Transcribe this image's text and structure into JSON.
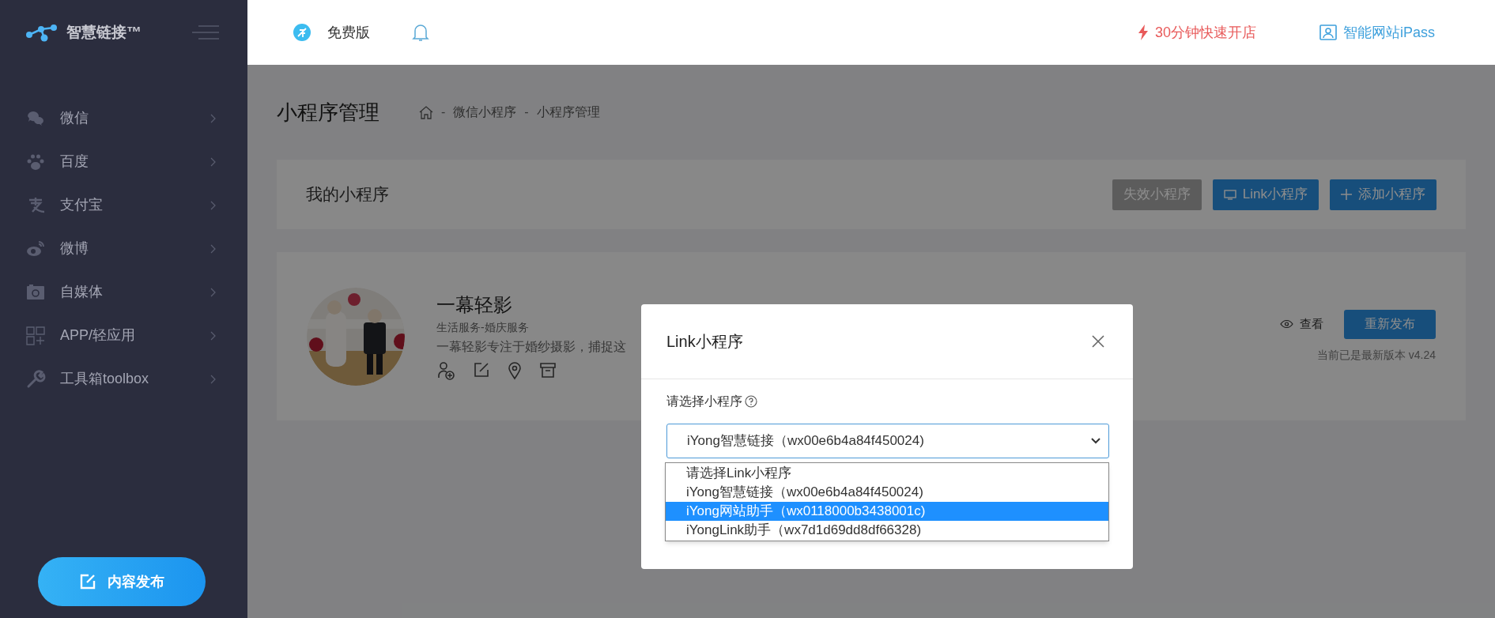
{
  "sidebar": {
    "brand": "智慧链接™",
    "items": [
      {
        "label": "微信"
      },
      {
        "label": "百度"
      },
      {
        "label": "支付宝"
      },
      {
        "label": "微博"
      },
      {
        "label": "自媒体"
      },
      {
        "label": "APP/轻应用"
      },
      {
        "label": "工具箱toolbox"
      }
    ],
    "publish_button": "内容发布"
  },
  "topbar": {
    "edition": "免费版",
    "links": [
      {
        "label": "30分钟快速开店",
        "kind": "shop"
      },
      {
        "label": "智能网站iPass",
        "kind": "site"
      }
    ]
  },
  "page": {
    "title": "小程序管理",
    "breadcrumb": [
      "微信小程序",
      "小程序管理"
    ],
    "separator": "-"
  },
  "panel": {
    "title": "我的小程序",
    "buttons": [
      {
        "label": "失效小程序",
        "kind": "plain",
        "disabled": true
      },
      {
        "label": "Link小程序",
        "kind": "link",
        "disabled": false
      },
      {
        "label": "添加小程序",
        "kind": "add",
        "disabled": false
      }
    ]
  },
  "app": {
    "name": "一幕轻影",
    "category": "生活服务-婚庆服务",
    "description": "一幕轻影专注于婚纱摄影，捕捉这",
    "view": "查看",
    "republish": "重新发布",
    "version": "当前已是最新版本 v4.24"
  },
  "modal": {
    "title": "Link小程序",
    "field_label": "请选择小程序",
    "select_value": "iYong智慧链接（wx00e6b4a84f450024)",
    "options": [
      {
        "label": "请选择Link小程序",
        "selected": false
      },
      {
        "label": "iYong智慧链接（wx00e6b4a84f450024)",
        "selected": false
      },
      {
        "label": "iYong网站助手（wx0118000b3438001c)",
        "selected": true
      },
      {
        "label": "iYongLink助手（wx7d1d69dd8df66328)",
        "selected": false
      }
    ]
  }
}
